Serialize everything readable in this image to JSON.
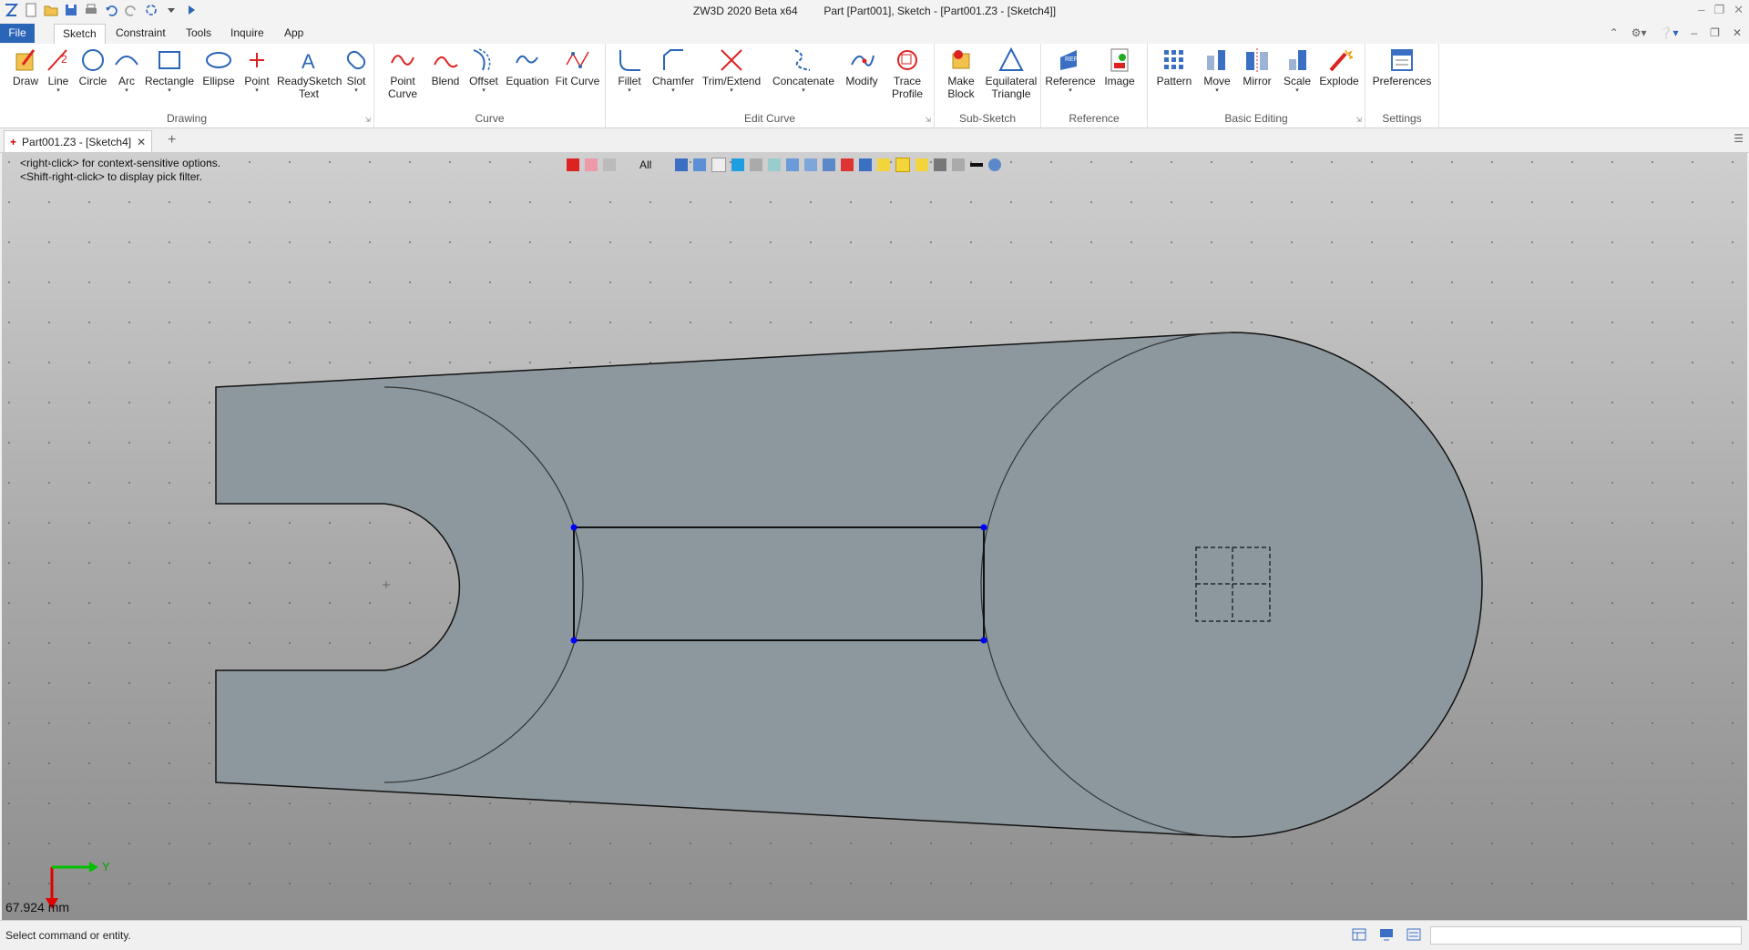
{
  "window": {
    "app_title": "ZW3D 2020 Beta x64",
    "doc_title": "Part [Part001],  Sketch - [Part001.Z3 - [Sketch4]]"
  },
  "menu": {
    "file": "File",
    "tabs": [
      "Sketch",
      "Constraint",
      "Tools",
      "Inquire",
      "App"
    ]
  },
  "ribbon": {
    "groups": {
      "drawing": "Drawing",
      "curve": "Curve",
      "edit_curve": "Edit Curve",
      "sub_sketch": "Sub-Sketch",
      "reference": "Reference",
      "basic_editing": "Basic Editing",
      "settings": "Settings"
    },
    "tools": {
      "draw": "Draw",
      "line": "Line",
      "circle": "Circle",
      "arc": "Arc",
      "rectangle": "Rectangle",
      "ellipse": "Ellipse",
      "point": "Point",
      "readysketch_text": "ReadySketch Text",
      "slot": "Slot",
      "point_curve": "Point Curve",
      "blend": "Blend",
      "offset": "Offset",
      "equation": "Equation",
      "fit_curve": "Fit Curve",
      "fillet": "Fillet",
      "chamfer": "Chamfer",
      "trim_extend": "Trim/Extend",
      "concatenate": "Concatenate",
      "modify": "Modify",
      "trace_profile": "Trace Profile",
      "make_block": "Make Block",
      "equilateral_triangle": "Equilateral Triangle",
      "reference": "Reference",
      "image": "Image",
      "pattern": "Pattern",
      "move": "Move",
      "mirror": "Mirror",
      "scale": "Scale",
      "explode": "Explode",
      "preferences": "Preferences"
    }
  },
  "doc_tab": {
    "label": "Part001.Z3 - [Sketch4]"
  },
  "viewport": {
    "hint_line1": "<right-click> for context-sensitive options.",
    "hint_line2": "<Shift-right-click> to display pick filter.",
    "filter_label": "All",
    "scale_label": "67.924 mm",
    "axis_y": "Y"
  },
  "status": {
    "message": "Select command or entity."
  },
  "colors": {
    "accent": "#2b65b8",
    "sketch_fill": "#8c989e",
    "vertex": "#0000ff",
    "axis_x": "#e00000",
    "axis_y": "#00c000"
  }
}
